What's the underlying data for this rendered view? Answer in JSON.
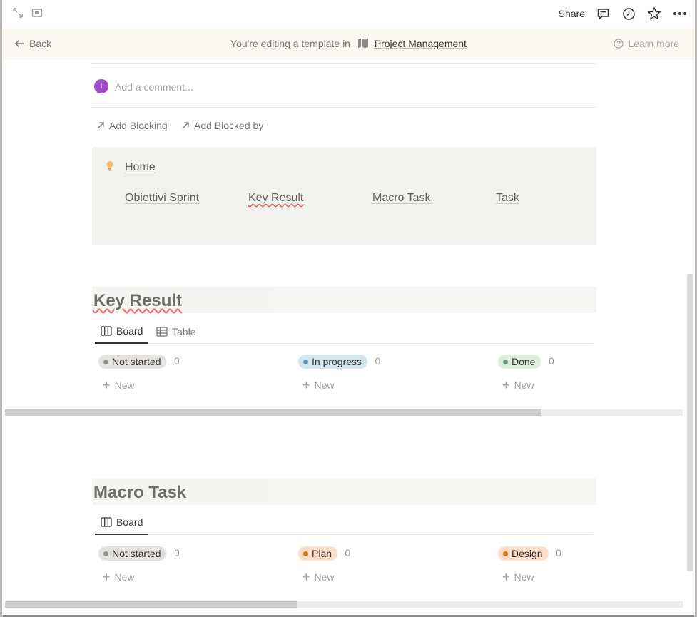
{
  "topbar": {
    "share_label": "Share",
    "icons": [
      "expand-icon",
      "peek-mode-icon",
      "comment-icon",
      "history-icon",
      "star-icon",
      "more-icon"
    ]
  },
  "banner": {
    "back_label": "Back",
    "editing_text": "You're editing a template in",
    "project_name": "Project Management",
    "learn_more_label": "Learn more"
  },
  "comment": {
    "avatar_initial": "I",
    "placeholder": "Add a comment..."
  },
  "relations": {
    "add_blocking": "Add Blocking",
    "add_blocked_by": "Add Blocked by"
  },
  "callout": {
    "home_link": "Home",
    "links": [
      "Obiettivi Sprint",
      "Key Result",
      "Macro Task",
      "Task"
    ]
  },
  "key_result": {
    "title": "Key Result",
    "tabs": [
      "Board",
      "Table"
    ],
    "columns": [
      {
        "label": "Not started",
        "count": "0",
        "color": "#91918e",
        "bg": "#e3e2e0"
      },
      {
        "label": "In progress",
        "count": "0",
        "color": "#5b97bd",
        "bg": "#d3e5ef"
      },
      {
        "label": "Done",
        "count": "0",
        "color": "#6c9b7d",
        "bg": "#dbeddb"
      }
    ],
    "new_label": "New",
    "scroll_fraction": 0.79
  },
  "macro_task": {
    "title": "Macro Task",
    "tabs": [
      "Board"
    ],
    "columns": [
      {
        "label": "Not started",
        "count": "0",
        "color": "#91918e",
        "bg": "#e3e2e0"
      },
      {
        "label": "Plan",
        "count": "0",
        "color": "#d9730d",
        "bg": "#fadec9"
      },
      {
        "label": "Design",
        "count": "0",
        "color": "#d9730d",
        "bg": "#fadec9"
      }
    ],
    "new_label": "New",
    "scroll_fraction": 0.43
  }
}
